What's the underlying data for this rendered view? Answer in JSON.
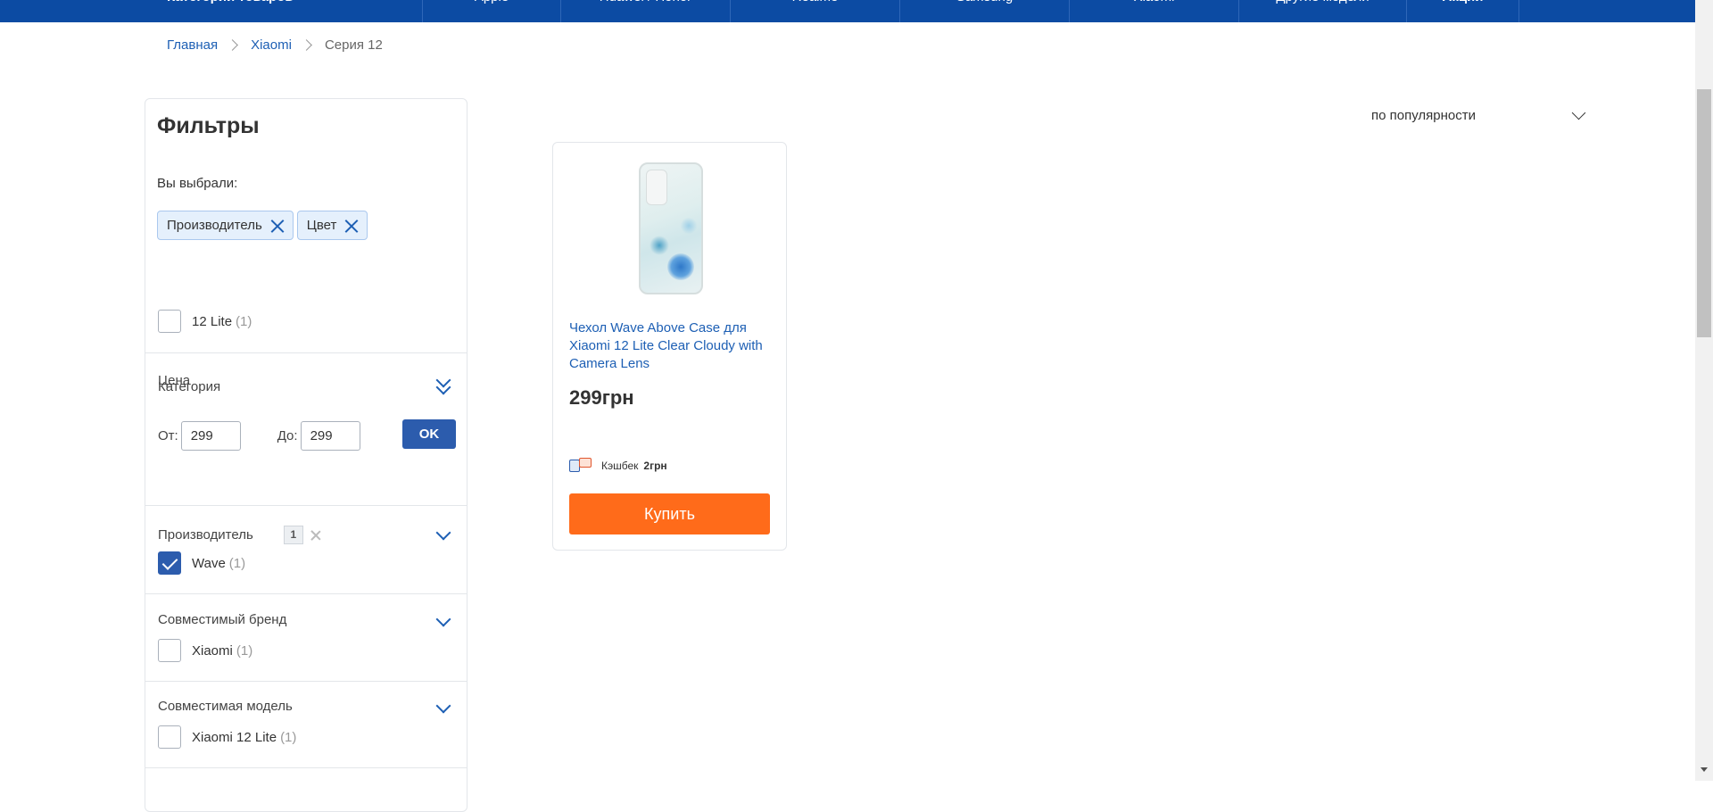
{
  "topnav": {
    "items": [
      "Категории товаров",
      "Apple",
      "Huawei / Honor",
      "Realme",
      "Samsung",
      "Xiaomi",
      "Другие модели",
      "Акции"
    ]
  },
  "breadcrumb": {
    "home": "Главная",
    "brand": "Xiaomi",
    "current": "Серия 12"
  },
  "filters": {
    "title": "Фильтры",
    "chosen_label": "Вы выбрали:",
    "chips": [
      "Производитель",
      "Цвет"
    ],
    "category": {
      "title": "Категория",
      "option": "12 Lite",
      "count": "(1)"
    },
    "price": {
      "title": "Цена",
      "from_label": "От:",
      "from_value": "299",
      "to_label": "До:",
      "to_value": "299",
      "ok": "OK"
    },
    "manufacturer": {
      "title": "Производитель",
      "badge": "1",
      "option": "Wave",
      "count": "(1)"
    },
    "compatible_brand": {
      "title": "Совместимый бренд",
      "option": "Xiaomi",
      "count": "(1)"
    },
    "compatible_model": {
      "title": "Совместимая модель",
      "option": "Xiaomi 12 Lite",
      "count": "(1)"
    }
  },
  "sort": {
    "selected": "по популярности"
  },
  "product": {
    "title": "Чехол Wave Above Case для Xiaomi 12 Lite Clear Cloudy with Camera Lens",
    "price": "299грн",
    "cashback_label": "Кэшбек",
    "cashback_value": "2грн",
    "buy_label": "Купить"
  },
  "colors": {
    "nav_bg": "#0c4ba3",
    "accent_blue": "#2c5cad",
    "buy_orange": "#ff6b1a",
    "link": "#1d5fb4"
  }
}
